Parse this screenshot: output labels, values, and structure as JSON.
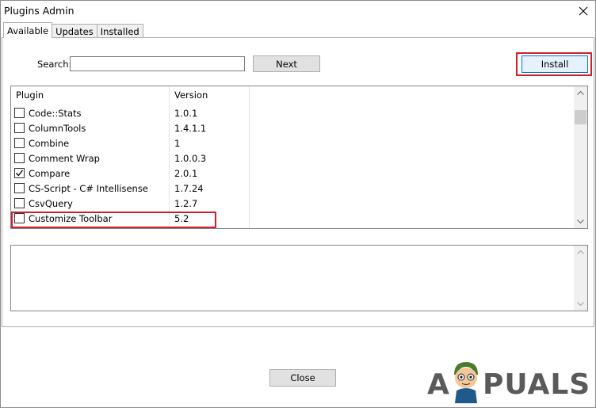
{
  "window": {
    "title": "Plugins Admin"
  },
  "tabs": [
    {
      "label": "Available",
      "active": true
    },
    {
      "label": "Updates",
      "active": false
    },
    {
      "label": "Installed",
      "active": false
    }
  ],
  "search": {
    "label": "Search:",
    "value": ""
  },
  "buttons": {
    "next": "Next",
    "install": "Install",
    "close": "Close"
  },
  "list": {
    "columns": [
      "Plugin",
      "Version"
    ],
    "rows": [
      {
        "name": "Code::Stats",
        "version": "1.0.1",
        "checked": false
      },
      {
        "name": "ColumnTools",
        "version": "1.4.1.1",
        "checked": false
      },
      {
        "name": "Combine",
        "version": "1",
        "checked": false
      },
      {
        "name": "Comment Wrap",
        "version": "1.0.0.3",
        "checked": false
      },
      {
        "name": "Compare",
        "version": "2.0.1",
        "checked": true
      },
      {
        "name": "CS-Script - C# Intellisense",
        "version": "1.7.24",
        "checked": false
      },
      {
        "name": "CsvQuery",
        "version": "1.2.7",
        "checked": false
      },
      {
        "name": "Customize Toolbar",
        "version": "5.2",
        "checked": false
      }
    ]
  },
  "description": {
    "text": ""
  },
  "colors": {
    "highlight": "#d21e2b",
    "install_border": "#0078d7"
  },
  "watermark": {
    "text_before": "A",
    "text_after": "PUALS"
  }
}
